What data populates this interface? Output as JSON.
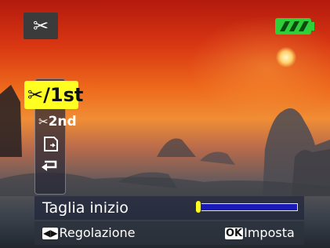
{
  "top_bar": {
    "mode_icon": "scissors-icon",
    "battery": {
      "icon": "battery-full-icon",
      "level": 1.0,
      "color": "#2fcf3a"
    }
  },
  "cut_menu": {
    "selected": {
      "icon": "scissors-icon",
      "label": "/1st"
    },
    "items": [
      {
        "icon": "scissors-icon",
        "label": "2nd"
      },
      {
        "icon": "save-icon"
      },
      {
        "icon": "return-icon"
      }
    ],
    "highlight_color": "#ffff22"
  },
  "trim_control": {
    "label": "Taglia inizio",
    "position": 0.0,
    "track_color": "#1a1ab8"
  },
  "hints": {
    "adjust": {
      "button": "◀▶",
      "text": "Regolazione"
    },
    "confirm": {
      "button": "OK",
      "text": "Imposta"
    }
  }
}
